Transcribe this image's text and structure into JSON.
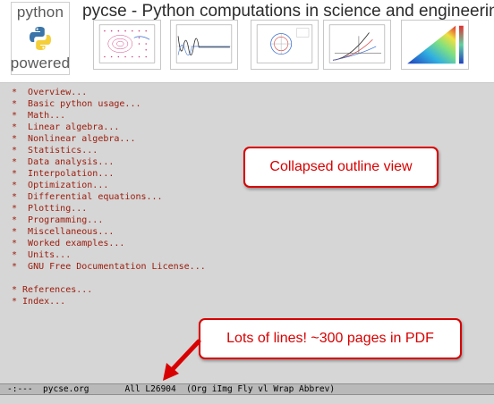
{
  "banner": {
    "logo": {
      "line1": "python",
      "line2": "powered",
      "icon": "python-logo-icon",
      "colors": {
        "blue": "#3a74a8",
        "yellow": "#f4cf3a"
      }
    },
    "title": "pycse - Python computations in science and engineering",
    "thumbnails": [
      {
        "icon": "phase-portrait-thumbnail"
      },
      {
        "icon": "oscillation-plot-thumbnail"
      },
      {
        "icon": "circle-contour-thumbnail"
      },
      {
        "icon": "curves-plot-thumbnail"
      },
      {
        "icon": "colored-triangle-thumbnail"
      }
    ]
  },
  "outline": {
    "items": [
      "*  Overview...",
      "*  Basic python usage...",
      "*  Math...",
      "*  Linear algebra...",
      "*  Nonlinear algebra...",
      "*  Statistics...",
      "*  Data analysis...",
      "*  Interpolation...",
      "*  Optimization...",
      "*  Differential equations...",
      "*  Plotting...",
      "*  Programming...",
      "*  Miscellaneous...",
      "*  Worked examples...",
      "*  Units...",
      "*  GNU Free Documentation License..."
    ],
    "footer_items": [
      "* References...",
      "* Index..."
    ],
    "text_color": "#9a1a0a"
  },
  "callouts": {
    "collapsed": "Collapsed outline view",
    "lines": "Lots of lines! ~300 pages in PDF",
    "color": "#d80000"
  },
  "modeline": {
    "text": "-:---  pycse.org       All L26904  (Org iImg Fly vl Wrap Abbrev)"
  }
}
